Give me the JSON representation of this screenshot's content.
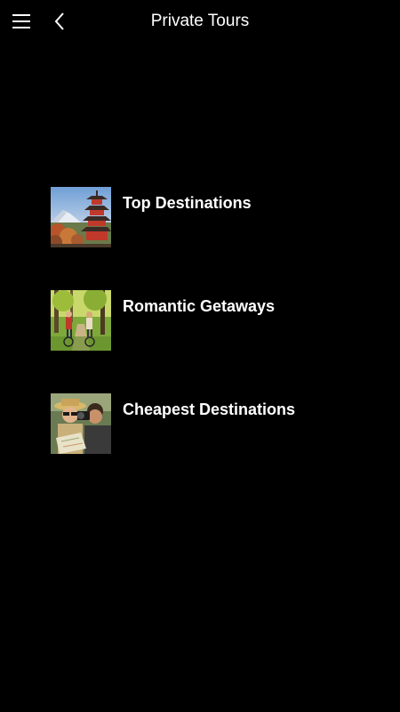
{
  "header": {
    "title": "Private Tours",
    "menu_icon": "hamburger-menu-icon",
    "back_icon": "chevron-left-icon"
  },
  "tours": [
    {
      "label": "Top Destinations",
      "image": "pagoda-mountain-photo"
    },
    {
      "label": "Romantic Getaways",
      "image": "couple-cycling-photo"
    },
    {
      "label": "Cheapest Destinations",
      "image": "travelers-with-camera-photo"
    }
  ],
  "colors": {
    "background": "#000000",
    "text": "#ffffff"
  }
}
